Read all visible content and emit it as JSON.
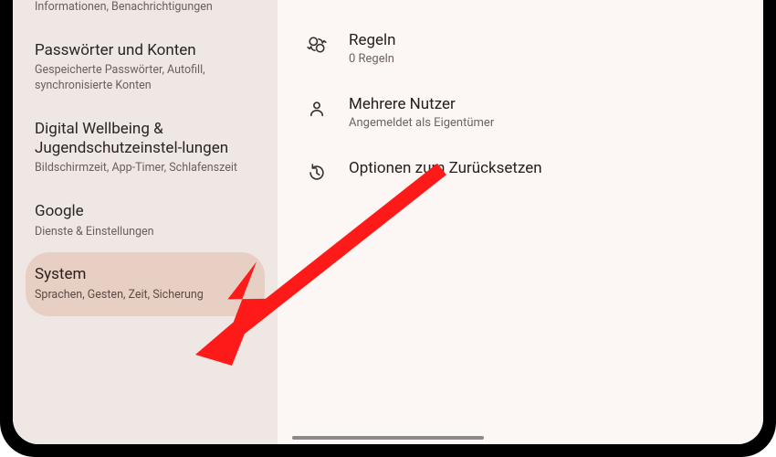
{
  "sidebar": {
    "items": [
      {
        "title": "",
        "sub": "Informationen, Benachrichtigungen"
      },
      {
        "title": "Passwörter und Konten",
        "sub": "Gespeicherte Passwörter, Autofill, synchronisierte Konten"
      },
      {
        "title": "Digital Wellbeing & Jugendschutzeinstel-lungen",
        "sub": "Bildschirmzeit, App-Timer, Schlafenszeit"
      },
      {
        "title": "Google",
        "sub": "Dienste & Einstellungen"
      },
      {
        "title": "System",
        "sub": "Sprachen, Gesten, Zeit, Sicherung"
      }
    ],
    "selected_index": 4
  },
  "main": {
    "rows": [
      {
        "icon": "rules-icon",
        "title": "Regeln",
        "sub": "0 Regeln"
      },
      {
        "icon": "users-icon",
        "title": "Mehrere Nutzer",
        "sub": "Angemeldet als Eigentümer"
      },
      {
        "icon": "reset-icon",
        "title": "Optionen zum Zurücksetzen",
        "sub": ""
      }
    ]
  },
  "annotation": {
    "arrow_color": "#ff1a1a"
  }
}
